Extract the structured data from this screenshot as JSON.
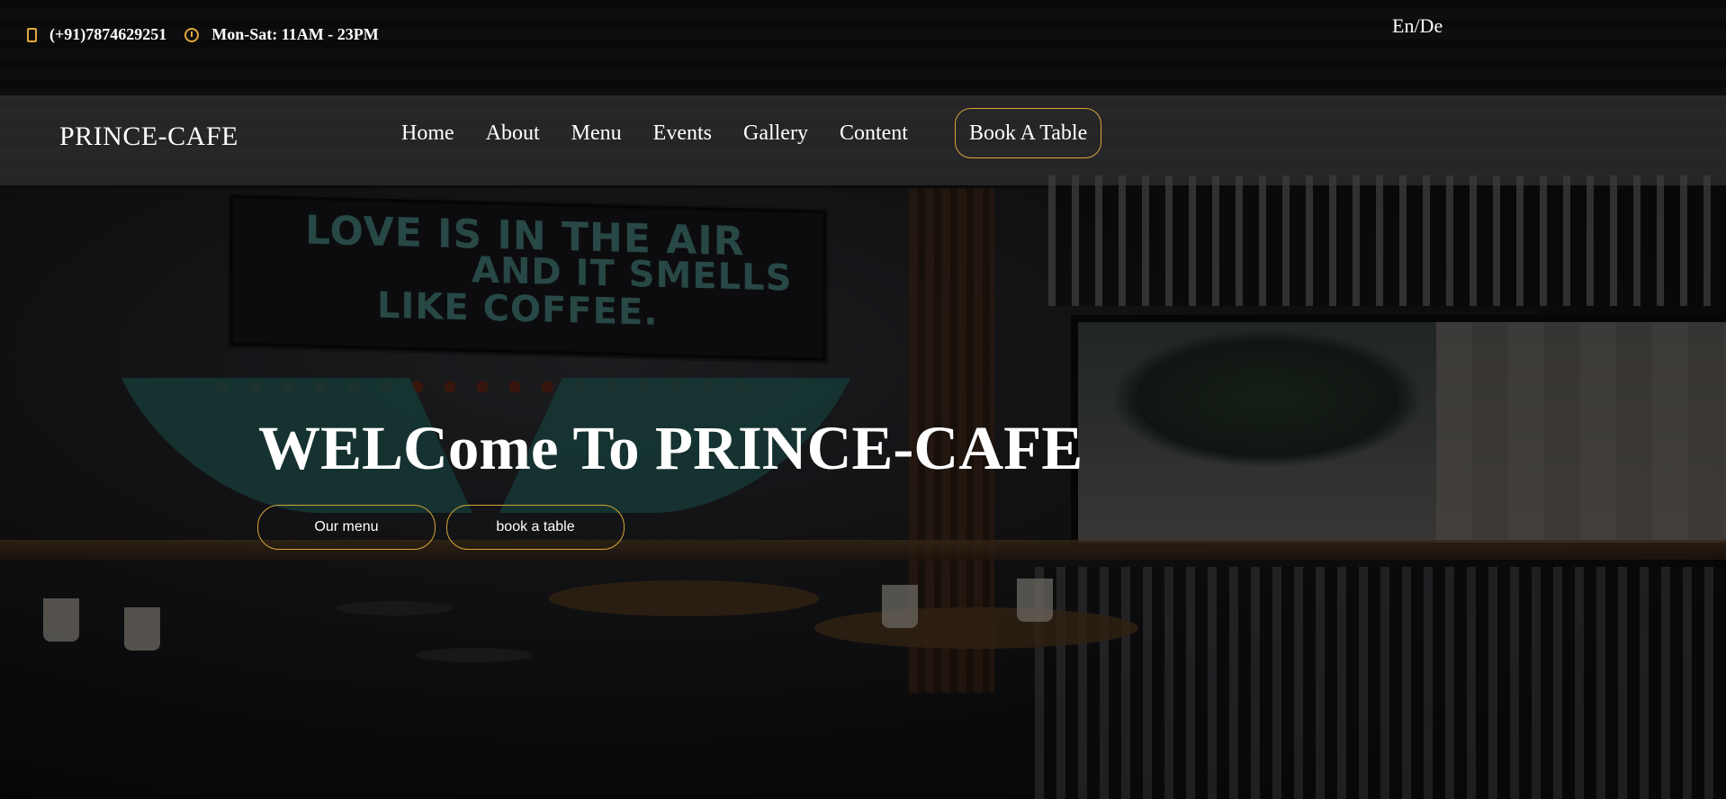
{
  "topbar": {
    "phone": "(+91)7874629251",
    "hours": "Mon-Sat: 11AM - 23PM",
    "language_toggle": "En/De",
    "accent_color": "#e0a83a"
  },
  "navbar": {
    "brand": "PRINCE-CAFE",
    "links": [
      "Home",
      "About",
      "Menu",
      "Events",
      "Gallery",
      "Content"
    ],
    "cta": "Book A Table"
  },
  "hero": {
    "title": "WELCome To PRINCE-CAFE",
    "buttons": [
      "Our menu",
      "book a table"
    ],
    "background_sign_text": [
      "LOVE IS IN THE AIR",
      "AND IT SMELLS",
      "LIKE COFFEE."
    ]
  },
  "colors": {
    "button_border": "#d9a53a",
    "text": "#ffffff"
  }
}
